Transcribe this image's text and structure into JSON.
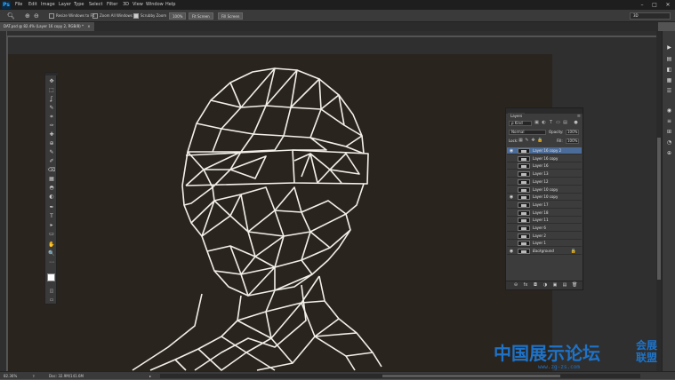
{
  "app": {
    "logo": "Ps",
    "menu": [
      "File",
      "Edit",
      "Image",
      "Layer",
      "Type",
      "Select",
      "Filter",
      "3D",
      "View",
      "Window",
      "Help"
    ],
    "window_controls": [
      "–",
      "□",
      "✕"
    ]
  },
  "options_bar": {
    "tool_icon": "zoom-icon",
    "resize_windows": "Resize Windows to Fit",
    "zoom_all": "Zoom All Windows",
    "scrubby_zoom": "Scrubby Zoom",
    "btn_100": "100%",
    "btn_fit": "Fit Screen",
    "btn_fill": "Fill Screen",
    "workspace": "3D"
  },
  "document": {
    "tab_title": "DAT.psd @ 82.4% (Layer 16 copy 2, RGB/8) *",
    "tab_close": "×"
  },
  "tools": [
    "✥",
    "⬚",
    "ʆ",
    "✎",
    "⌗",
    "✑",
    "✚",
    "⊕",
    "✎",
    "✐",
    "⌫",
    "▦",
    "◓",
    "◐",
    "✒",
    "T",
    "▸",
    "▭",
    "✋",
    "🔍",
    "⋯"
  ],
  "right_dock_icons": [
    "▶",
    "▤",
    "◧",
    "▦",
    "☰",
    "◉",
    "≡",
    "⊞",
    "◔",
    "⊕"
  ],
  "layers_panel": {
    "tab": "Layers",
    "menu": "≡",
    "kind": "ρ Kind",
    "blend_mode": "Normal",
    "opacity_label": "Opacity:",
    "opacity_value": "100%",
    "lock_label": "Lock:",
    "fill_label": "Fill:",
    "fill_value": "100%",
    "layers": [
      {
        "name": "Layer 16 copy 2",
        "visible": true,
        "selected": true
      },
      {
        "name": "Layer 16 copy",
        "visible": false,
        "selected": false
      },
      {
        "name": "Layer 16",
        "visible": false,
        "selected": false
      },
      {
        "name": "Layer 13",
        "visible": false,
        "selected": false
      },
      {
        "name": "Layer 12",
        "visible": false,
        "selected": false
      },
      {
        "name": "Layer 10 copy",
        "visible": false,
        "selected": false
      },
      {
        "name": "Layer 10 copy",
        "visible": true,
        "selected": false
      },
      {
        "name": "Layer 17",
        "visible": false,
        "selected": false
      },
      {
        "name": "Layer 18",
        "visible": false,
        "selected": false
      },
      {
        "name": "Layer 11",
        "visible": false,
        "selected": false
      },
      {
        "name": "Layer 6",
        "visible": false,
        "selected": false
      },
      {
        "name": "Layer 2",
        "visible": false,
        "selected": false
      },
      {
        "name": "Layer 1",
        "visible": false,
        "selected": false
      },
      {
        "name": "Background",
        "visible": true,
        "selected": false,
        "locked": true
      }
    ],
    "footer": [
      "⊖",
      "fx",
      "◘",
      "◑",
      "▣",
      "▤",
      "🗑"
    ]
  },
  "status": {
    "zoom": "82.36%",
    "doc": "Doc: 32.9M/141.6M",
    "arrow": "▸"
  },
  "watermark": {
    "cn": "中国展示论坛",
    "side": "会展联盟",
    "url": "www.zg-zs.com"
  },
  "colors": {
    "canvas": "#2a241f",
    "line_art": "#f2f0e8",
    "selection": "#4b6b99",
    "watermark": "#1e73c8"
  }
}
